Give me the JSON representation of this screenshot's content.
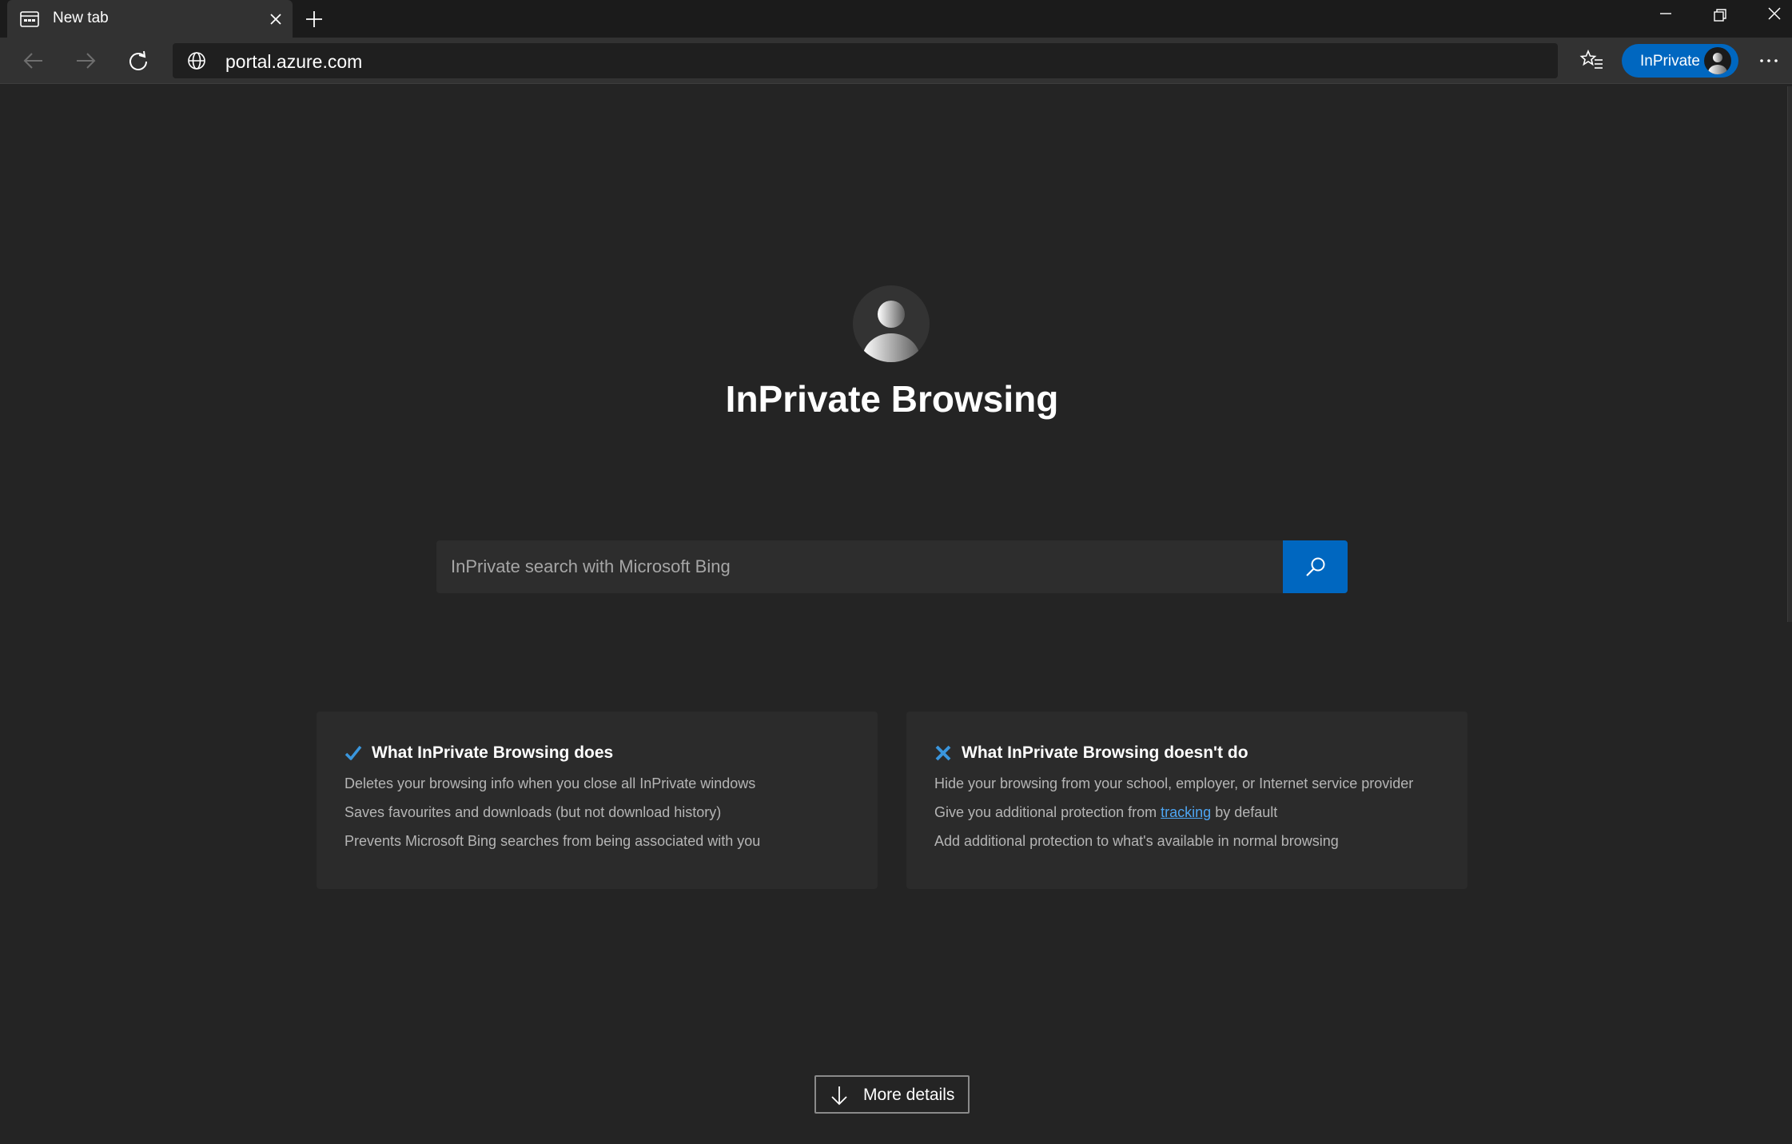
{
  "tab": {
    "title": "New tab",
    "favicon": "new-tab-page-icon",
    "close_icon": "close-icon"
  },
  "window_controls": [
    "minimize-icon",
    "restore-icon",
    "close-icon"
  ],
  "toolbar": {
    "url": "portal.azure.com",
    "inprivate_label": "InPrivate",
    "icons": [
      "back-arrow-icon",
      "forward-arrow-icon",
      "refresh-icon",
      "globe-icon",
      "favorites-icon",
      "more-icon"
    ]
  },
  "hero": {
    "title": "InPrivate Browsing"
  },
  "search": {
    "placeholder": "InPrivate search with Microsoft Bing"
  },
  "cards": {
    "does": {
      "title": "What InPrivate Browsing does",
      "icon": "checkmark-icon",
      "lines": [
        "Deletes your browsing info when you close all InPrivate windows",
        "Saves favourites and downloads (but not download history)",
        "Prevents Microsoft Bing searches from being associated with you"
      ]
    },
    "doesnt": {
      "title": "What InPrivate Browsing doesn't do",
      "icon": "x-icon",
      "line1": "Hide your browsing from your school, employer, or Internet service provider",
      "line2_before": "Give you additional protection from ",
      "line2_link": "tracking",
      "line2_after": " by default",
      "line3": "Add additional protection to what's available in normal browsing"
    }
  },
  "more_details": {
    "label": "More details"
  },
  "colors": {
    "accent": "#0067c0",
    "background": "#242424",
    "card": "#2b2b2b",
    "link": "#4ea5f2",
    "check": "#3a96dd"
  }
}
